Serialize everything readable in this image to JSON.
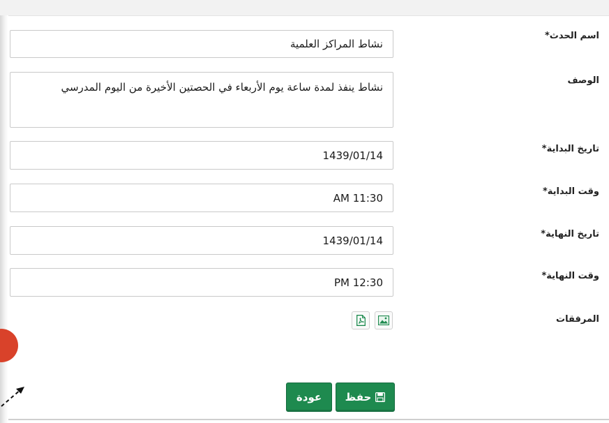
{
  "colors": {
    "accent": "#1e8a4f",
    "badge": "#d9422a"
  },
  "form": {
    "event_name": {
      "label": "اسم الحدث*",
      "value": "نشاط المراكز العلمية"
    },
    "description": {
      "label": "الوصف",
      "value": "نشاط ينفذ لمدة ساعة يوم الأربعاء في الحصتين الأخيرة من اليوم المدرسي"
    },
    "start_date": {
      "label": "تاريخ البداية*",
      "value": "1439/01/14"
    },
    "start_time": {
      "label": "وقت البداية*",
      "value": "11:30 AM"
    },
    "end_date": {
      "label": "تاريخ النهاية*",
      "value": "1439/01/14"
    },
    "end_time": {
      "label": "وقت النهاية*",
      "value": "12:30 PM"
    },
    "attachments": {
      "label": "المرفقات",
      "icons": [
        "image-icon",
        "pdf-icon"
      ]
    }
  },
  "actions": {
    "save_label": "حفظ",
    "save_icon": "floppy-disk-icon",
    "back_label": "عودة"
  }
}
